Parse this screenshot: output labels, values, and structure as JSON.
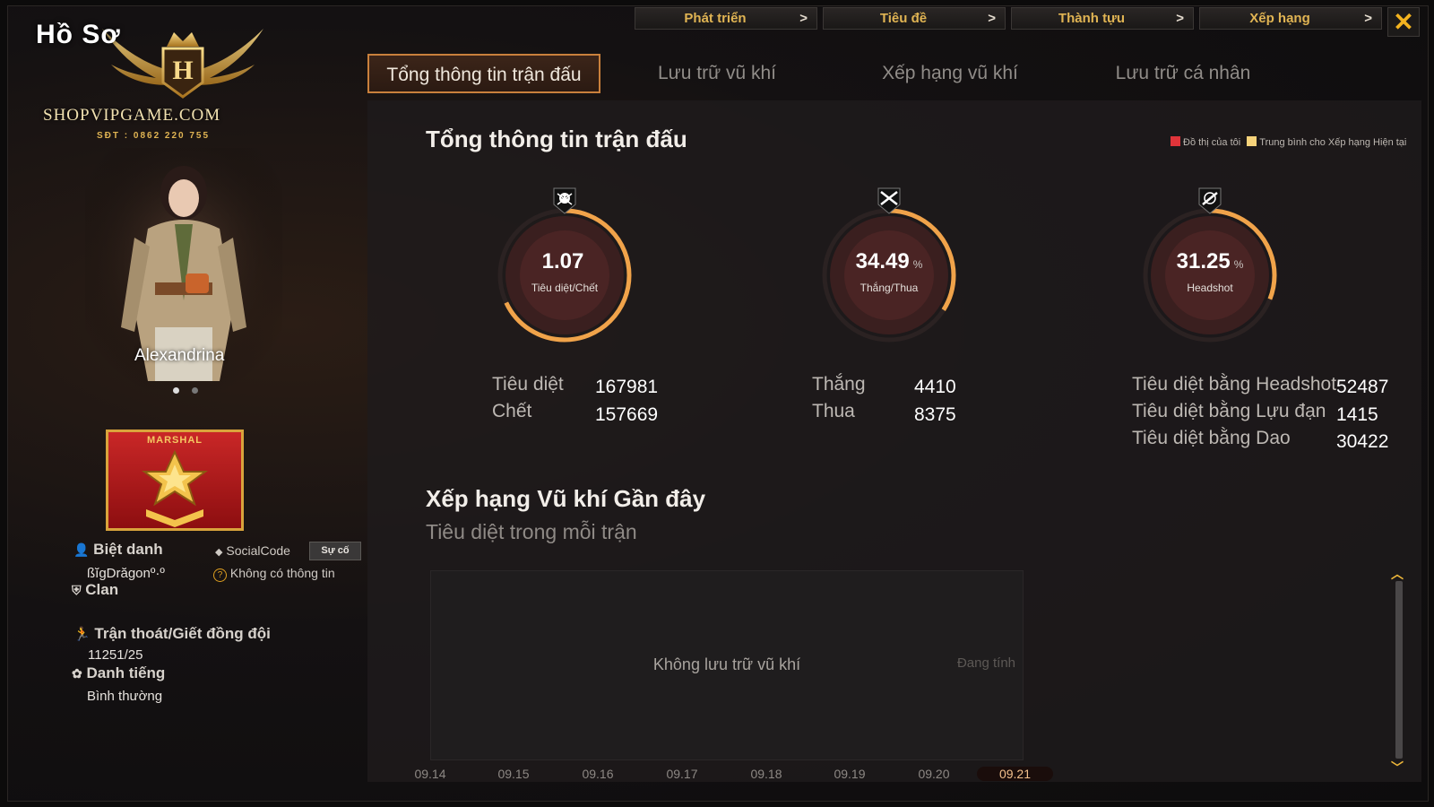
{
  "logo": {
    "title": "Hồ Sơ",
    "site": "SHOPVIPGAME.COM",
    "phone": "SĐT : 0862 220 755",
    "emblem_letter": "H"
  },
  "character": {
    "name": "Alexandrina"
  },
  "rank": {
    "label": "MARSHAL"
  },
  "profile": {
    "nickname_label": "Biệt danh",
    "nickname_value": "ßĭgDrăgonº·º",
    "socialcode_label": "SocialCode",
    "incident_button": "Sự cố",
    "no_info": "Không có thông tin",
    "clan_label": "Clan",
    "escape_label": "Trận thoát/Giết đồng đội",
    "escape_value": "11251/25",
    "reputation_label": "Danh tiếng",
    "reputation_value": "Bình thường"
  },
  "top_tabs": [
    {
      "label": "Phát triển",
      "arrow": ">"
    },
    {
      "label": "Tiêu đề",
      "arrow": ">"
    },
    {
      "label": "Thành tựu",
      "arrow": ">"
    },
    {
      "label": "Xếp hạng",
      "arrow": ">"
    }
  ],
  "close_label": "✕",
  "main_tabs": [
    {
      "label": "Tổng thông tin trận đấu"
    },
    {
      "label": "Lưu trữ vũ khí"
    },
    {
      "label": "Xếp hạng vũ khí"
    },
    {
      "label": "Lưu trữ cá nhân"
    }
  ],
  "summary": {
    "title": "Tổng thông tin trận đấu",
    "legend_mine": "Đồ thị của tôi",
    "legend_avg": "Trung bình cho Xếp hạng Hiện tại",
    "legend_mine_color": "#e0343a",
    "legend_avg_color": "#f5d27a"
  },
  "gauges": [
    {
      "value": "1.07",
      "unit": "",
      "caption": "Tiêu diệt/Chết",
      "icon": "skull-crossbones-icon",
      "fill": 0.68
    },
    {
      "value": "34.49",
      "unit": "%",
      "caption": "Thắng/Thua",
      "icon": "crossed-guns-icon",
      "fill": 0.34
    },
    {
      "value": "31.25",
      "unit": "%",
      "caption": "Headshot",
      "icon": "crosshair-gun-icon",
      "fill": 0.31
    }
  ],
  "stats": {
    "kills_label": "Tiêu diệt",
    "kills_value": "167981",
    "deaths_label": "Chết",
    "deaths_value": "157669",
    "wins_label": "Thắng",
    "wins_value": "4410",
    "losses_label": "Thua",
    "losses_value": "8375",
    "headshot_kills_label": "Tiêu diệt bằng Headshot",
    "headshot_kills_value": "52487",
    "grenade_kills_label": "Tiêu diệt bằng Lựu đạn",
    "grenade_kills_value": "1415",
    "knife_kills_label": "Tiêu diệt bằng Dao",
    "knife_kills_value": "30422"
  },
  "weapon_ranking": {
    "title": "Xếp hạng Vũ khí Gần đây",
    "subtitle": "Tiêu diệt trong mỗi trận",
    "empty_text": "Không lưu trữ vũ khí",
    "status_text": "Đang tính",
    "dates": [
      "09.14",
      "09.15",
      "09.16",
      "09.17",
      "09.18",
      "09.19",
      "09.20",
      "09.21"
    ],
    "active_date": "09.21"
  }
}
